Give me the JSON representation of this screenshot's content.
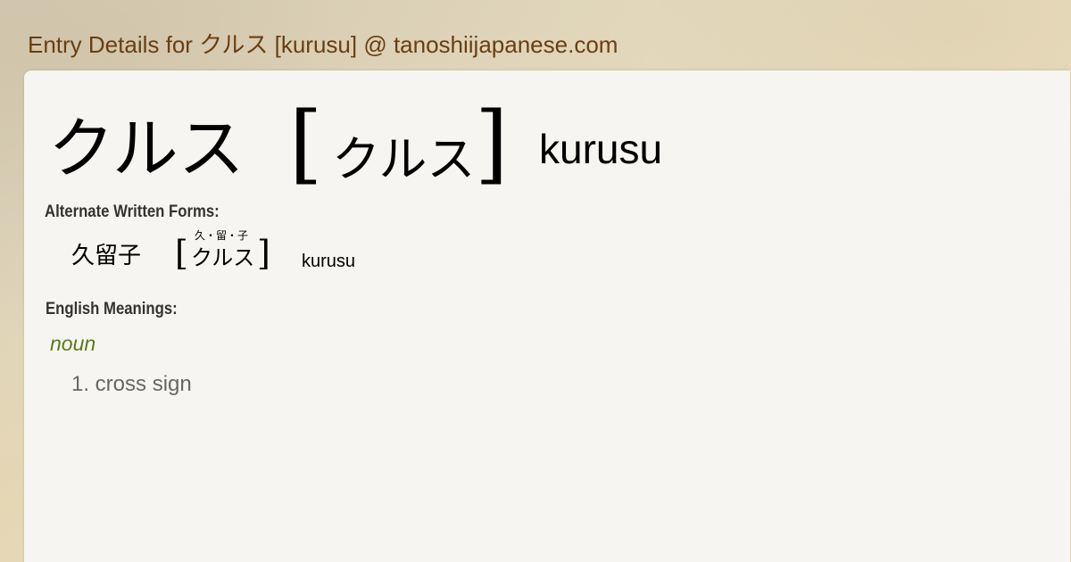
{
  "header": {
    "title": "Entry Details for クルス [kurusu] @ tanoshiijapanese.com"
  },
  "entry": {
    "kanji": "クルス",
    "bracket_open": "[",
    "reading": "クルス",
    "bracket_close": "]",
    "romaji": "kurusu"
  },
  "alternate": {
    "label": "Alternate Written Forms:",
    "forms": [
      {
        "kanji": "久留子",
        "bracket_open": "[",
        "furigana": "久・留・子",
        "reading": "クルス",
        "bracket_close": "]",
        "romaji": "kurusu"
      }
    ]
  },
  "meanings": {
    "label": "English Meanings:",
    "part_of_speech": "noun",
    "items": [
      {
        "text": "1. cross sign"
      }
    ]
  },
  "colors": {
    "header_text": "#6b3e11",
    "part_of_speech": "#5a7a19",
    "meaning_text": "#666666",
    "card_background": "#f7f5f1"
  }
}
